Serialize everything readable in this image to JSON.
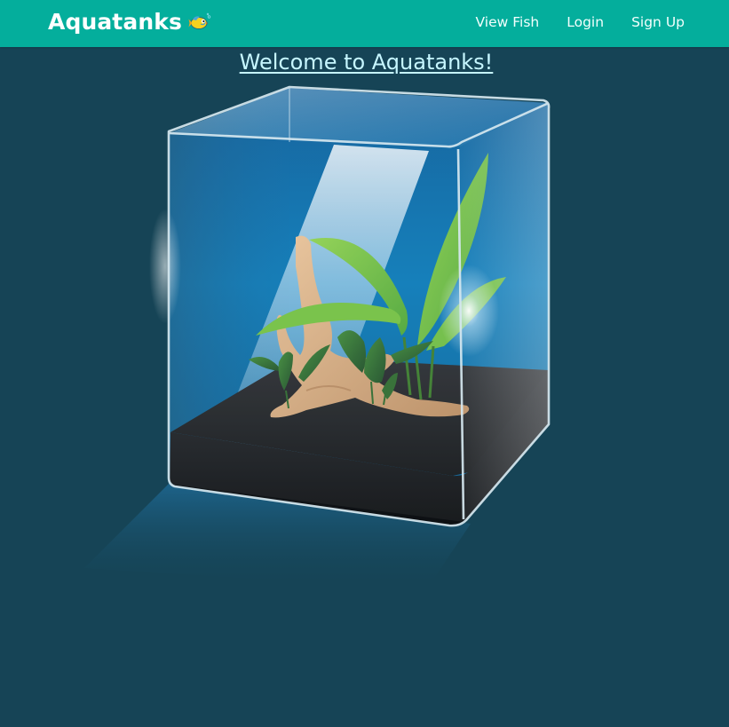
{
  "nav": {
    "brand": "Aquatanks",
    "brand_icon": "fish-icon",
    "links": [
      {
        "label": "View Fish"
      },
      {
        "label": "Login"
      },
      {
        "label": "Sign Up"
      }
    ]
  },
  "main": {
    "heading": "Welcome to Aquatanks!",
    "hero_image": "aquarium-tank-illustration"
  },
  "colors": {
    "navbar": "#04ae9c",
    "background": "#164456",
    "heading": "#c6f6ff",
    "nav_text": "#ffffff"
  }
}
